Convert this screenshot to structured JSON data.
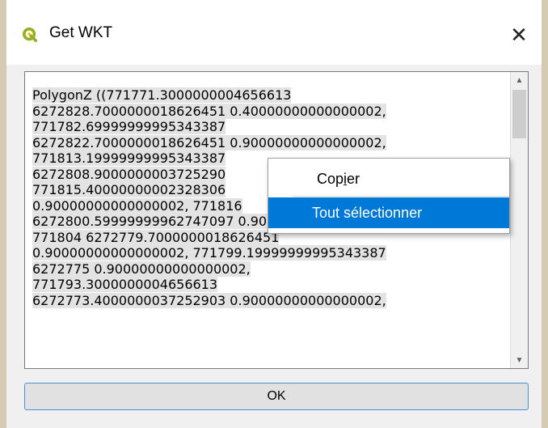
{
  "window": {
    "title": "Get WKT",
    "close_glyph": "✕"
  },
  "wkt_text": {
    "lines": [
      "PolygonZ ((771771.3000000004656613",
      "6272828.7000000018626451 0.40000000000000002,",
      "771782.69999999995343387",
      "6272822.7000000018626451 0.90000000000000002,",
      "771813.19999999995343387",
      "6272808.9000000003725290",
      "771815.40000000002328306",
      "0.90000000000000002, 771816",
      "6272800.59999999962747097 0.90000000000000002,",
      "771804 6272779.7000000018626451",
      "0.90000000000000002, 771799.19999999995343387",
      "6272775 0.90000000000000002,",
      "771793.3000000004656613",
      "6272773.4000000037252903 0.90000000000000002,"
    ]
  },
  "scrollbar": {
    "up_glyph": "▲",
    "down_glyph": "▼"
  },
  "context_menu": {
    "copy_prefix": "Cop",
    "copy_underlined": "i",
    "copy_suffix": "er",
    "select_all": "Tout sélectionner"
  },
  "ok_button": {
    "label": "OK"
  },
  "colors": {
    "highlight": "#0078d7",
    "qgis_green": "#93b023",
    "text_selection": "#e3e3e3"
  }
}
